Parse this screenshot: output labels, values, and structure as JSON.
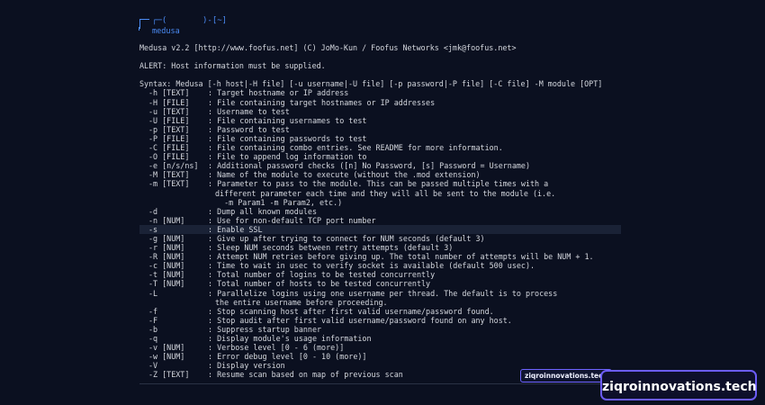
{
  "prompt": {
    "open": "┌─(",
    "user": "medusa",
    "tail": ")-[~]"
  },
  "header": {
    "version_line": "Medusa v2.2 [http://www.foofus.net] (C) JoMo-Kun / Foofus Networks <jmk@foofus.net>",
    "alert_line": "ALERT: Host information must be supplied.",
    "syntax_line": "Syntax: Medusa [-h host|-H file] [-u username|-U file] [-p password|-P file] [-C file] -M module [OPT]"
  },
  "options": [
    {
      "flag": "-h [TEXT]",
      "desc": ": Target hostname or IP address"
    },
    {
      "flag": "-H [FILE]",
      "desc": ": File containing target hostnames or IP addresses"
    },
    {
      "flag": "-u [TEXT]",
      "desc": ": Username to test"
    },
    {
      "flag": "-U [FILE]",
      "desc": ": File containing usernames to test"
    },
    {
      "flag": "-p [TEXT]",
      "desc": ": Password to test"
    },
    {
      "flag": "-P [FILE]",
      "desc": ": File containing passwords to test"
    },
    {
      "flag": "-C [FILE]",
      "desc": ": File containing combo entries. See README for more information."
    },
    {
      "flag": "-O [FILE]",
      "desc": ": File to append log information to"
    },
    {
      "flag": "-e [n/s/ns]",
      "desc": ": Additional password checks ([n] No Password, [s] Password = Username)"
    },
    {
      "flag": "-M [TEXT]",
      "desc": ": Name of the module to execute (without the .mod extension)"
    },
    {
      "flag": "-m [TEXT]",
      "desc": ": Parameter to pass to the module. This can be passed multiple times with a"
    },
    {
      "cont": "different parameter each time and they will all be sent to the module (i.e."
    },
    {
      "cont": "  -m Param1 -m Param2, etc.)"
    },
    {
      "flag": "-d",
      "desc": ": Dump all known modules"
    },
    {
      "flag": "-n [NUM]",
      "desc": ": Use for non-default TCP port number"
    },
    {
      "flag": "-s",
      "desc": ": Enable SSL",
      "highlight": true
    },
    {
      "flag": "-g [NUM]",
      "desc": ": Give up after trying to connect for NUM seconds (default 3)"
    },
    {
      "flag": "-r [NUM]",
      "desc": ": Sleep NUM seconds between retry attempts (default 3)"
    },
    {
      "flag": "-R [NUM]",
      "desc": ": Attempt NUM retries before giving up. The total number of attempts will be NUM + 1."
    },
    {
      "flag": "-c [NUM]",
      "desc": ": Time to wait in usec to verify socket is available (default 500 usec)."
    },
    {
      "flag": "-t [NUM]",
      "desc": ": Total number of logins to be tested concurrently"
    },
    {
      "flag": "-T [NUM]",
      "desc": ": Total number of hosts to be tested concurrently"
    },
    {
      "flag": "-L",
      "desc": ": Parallelize logins using one username per thread. The default is to process"
    },
    {
      "cont": "the entire username before proceeding."
    },
    {
      "flag": "-f",
      "desc": ": Stop scanning host after first valid username/password found."
    },
    {
      "flag": "-F",
      "desc": ": Stop audit after first valid username/password found on any host."
    },
    {
      "flag": "-b",
      "desc": ": Suppress startup banner"
    },
    {
      "flag": "-q",
      "desc": ": Display module's usage information"
    },
    {
      "flag": "-v [NUM]",
      "desc": ": Verbose level [0 - 6 (more)]"
    },
    {
      "flag": "-w [NUM]",
      "desc": ": Error debug level [0 - 10 (more)]"
    },
    {
      "flag": "-V",
      "desc": ": Display version"
    },
    {
      "flag": "-Z [TEXT]",
      "desc": ": Resume scan based on map of previous scan"
    }
  ],
  "watermark": {
    "small": "ziqroinnovations.tech",
    "large": "ziqroinnovations.tech"
  },
  "colors": {
    "background": "#0b1020",
    "prompt": "#4b8bf4",
    "text": "#d4d7de",
    "watermark_border": "#6b5cf6"
  }
}
